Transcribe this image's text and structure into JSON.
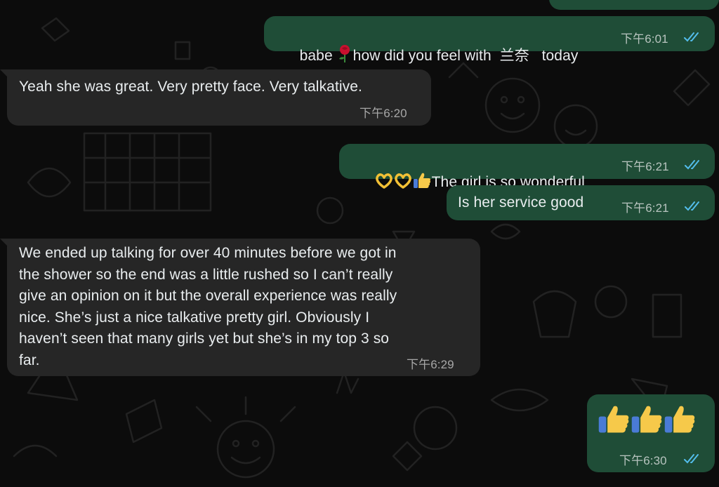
{
  "colors": {
    "background": "#0c0c0c",
    "outgoing_bubble": "#1f4d37",
    "incoming_bubble": "#262626",
    "text": "#e9edef",
    "read_ticks": "#53bdeb"
  },
  "messages": [
    {
      "direction": "outgoing",
      "text_before": "babe ",
      "emoji": "rose",
      "text_after": "how did you feel with  兰奈   today",
      "time": "下午6:01",
      "status": "read"
    },
    {
      "direction": "incoming",
      "text": "Yeah she was great. Very pretty face. Very talkative.",
      "time": "下午6:20"
    },
    {
      "direction": "outgoing",
      "emojis": [
        "heart-hands",
        "heart-hands",
        "thumbs-up"
      ],
      "text": "The girl is so wonderful",
      "time": "下午6:21",
      "status": "read"
    },
    {
      "direction": "outgoing",
      "text": "Is her service good",
      "time": "下午6:21",
      "status": "read"
    },
    {
      "direction": "incoming",
      "lines": [
        "We ended up talking for over 40 minutes before we got in",
        "the shower so the end was a little rushed so I can’t really",
        "give an opinion on it but the overall experience was really",
        "nice. She’s just a nice talkative pretty girl. Obviously I",
        "haven’t seen that many girls yet but she’s in my top 3 so",
        "far."
      ],
      "time": "下午6:29"
    },
    {
      "direction": "outgoing",
      "emojis": [
        "thumbs-up",
        "thumbs-up",
        "thumbs-up"
      ],
      "time": "下午6:30",
      "status": "read"
    }
  ]
}
